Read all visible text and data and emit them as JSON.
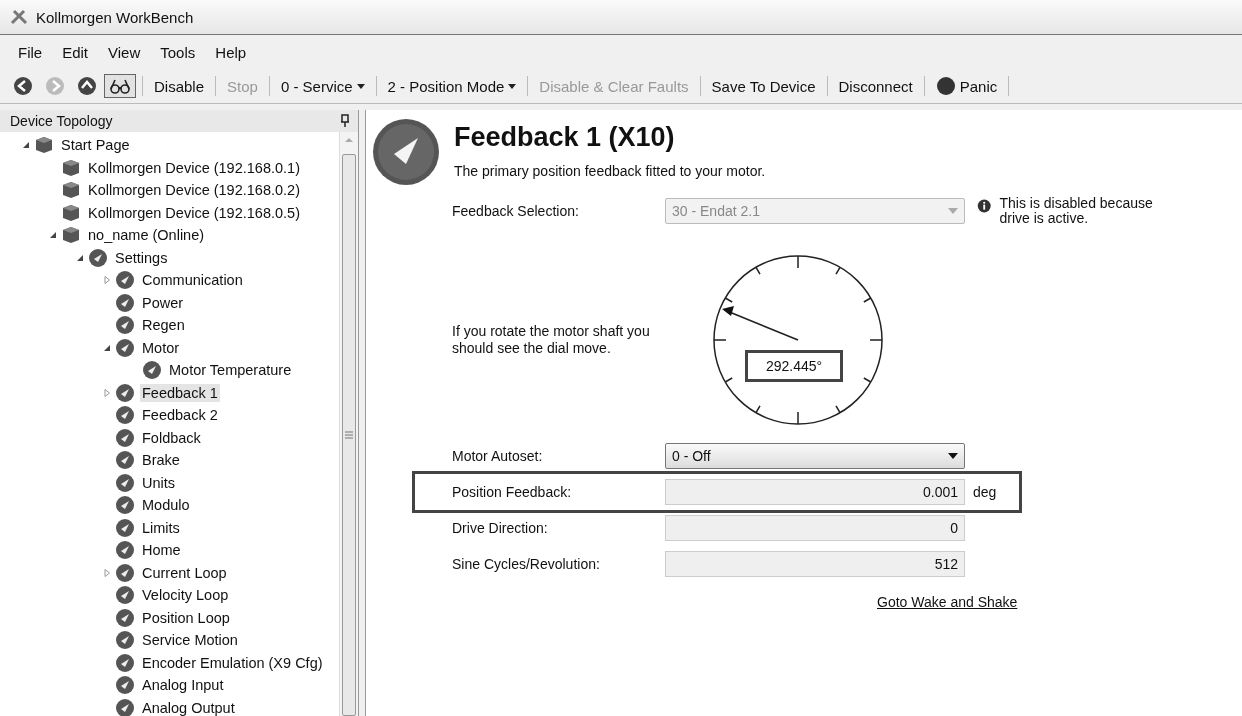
{
  "window": {
    "title": "Kollmorgen WorkBench"
  },
  "menu": [
    "File",
    "Edit",
    "View",
    "Tools",
    "Help"
  ],
  "toolbar": [
    {
      "kind": "nav",
      "disabled": false
    },
    {
      "kind": "nav",
      "disabled": true
    },
    {
      "kind": "nav",
      "disabled": false
    },
    {
      "kind": "toggle",
      "pressed": true
    },
    {
      "kind": "button",
      "label": "Disable",
      "disabled": false
    },
    {
      "kind": "button",
      "label": "Stop",
      "disabled": true
    },
    {
      "kind": "dropdown",
      "label": "0 - Service",
      "disabled": false
    },
    {
      "kind": "dropdown",
      "label": "2 - Position Mode",
      "disabled": false
    },
    {
      "kind": "button",
      "label": "Disable & Clear Faults",
      "disabled": true
    },
    {
      "kind": "button",
      "label": "Save To Device",
      "disabled": false
    },
    {
      "kind": "button",
      "label": "Disconnect",
      "disabled": false
    },
    {
      "kind": "panic",
      "label": "Panic",
      "disabled": false
    }
  ],
  "sidebar": {
    "title": "Device Topology",
    "items": [
      {
        "label": "Start Page",
        "expanded": true,
        "selected": false,
        "children": [
          {
            "label": "Kollmorgen Device (192.168.0.1)",
            "selected": false
          },
          {
            "label": "Kollmorgen Device (192.168.0.2)",
            "selected": false
          },
          {
            "label": "Kollmorgen Device (192.168.0.5)",
            "selected": false
          },
          {
            "label": "no_name (Online)",
            "expanded": true,
            "selected": false,
            "children": [
              {
                "label": "Settings",
                "expanded": true,
                "selected": false,
                "children": [
                  {
                    "label": "Communication",
                    "expanded": false,
                    "selected": false
                  },
                  {
                    "label": "Power",
                    "selected": false
                  },
                  {
                    "label": "Regen",
                    "selected": false
                  },
                  {
                    "label": "Motor",
                    "expanded": true,
                    "selected": false,
                    "children": [
                      {
                        "label": "Motor Temperature",
                        "selected": false
                      }
                    ]
                  },
                  {
                    "label": "Feedback 1",
                    "expanded": false,
                    "selected": true
                  },
                  {
                    "label": "Feedback 2",
                    "selected": false
                  },
                  {
                    "label": "Foldback",
                    "selected": false
                  },
                  {
                    "label": "Brake",
                    "selected": false
                  },
                  {
                    "label": "Units",
                    "selected": false
                  },
                  {
                    "label": "Modulo",
                    "selected": false
                  },
                  {
                    "label": "Limits",
                    "selected": false
                  },
                  {
                    "label": "Home",
                    "selected": false
                  },
                  {
                    "label": "Current Loop",
                    "expanded": false,
                    "selected": false
                  },
                  {
                    "label": "Velocity Loop",
                    "selected": false
                  },
                  {
                    "label": "Position Loop",
                    "selected": false
                  },
                  {
                    "label": "Service Motion",
                    "selected": false
                  },
                  {
                    "label": "Encoder Emulation (X9 Cfg)",
                    "selected": false
                  },
                  {
                    "label": "Analog Input",
                    "selected": false
                  },
                  {
                    "label": "Analog Output",
                    "selected": false
                  }
                ]
              }
            ]
          }
        ]
      }
    ]
  },
  "page": {
    "title": "Feedback 1 (X10)",
    "subtitle": "The primary position feedback fitted to your motor.",
    "feedback_selection": {
      "label": "Feedback Selection:",
      "value": "30 - Endat 2.1",
      "disabled": true,
      "note": "This is disabled because drive is active."
    },
    "instruction": "If you rotate the motor shaft you should see the dial move.",
    "dial": {
      "reading": "292.445°",
      "highlighted": true
    },
    "fields": [
      {
        "kind": "dropdown",
        "label": "Motor Autoset:",
        "value": "0 - Off",
        "highlighted": false
      },
      {
        "kind": "readout",
        "label": "Position Feedback:",
        "value": "0.001",
        "unit": "deg",
        "highlighted": true
      },
      {
        "kind": "readout",
        "label": "Drive Direction:",
        "value": "0",
        "highlighted": false
      },
      {
        "kind": "readout",
        "label": "Sine Cycles/Revolution:",
        "value": "512",
        "highlighted": false
      }
    ],
    "link": "Goto Wake and Shake"
  }
}
